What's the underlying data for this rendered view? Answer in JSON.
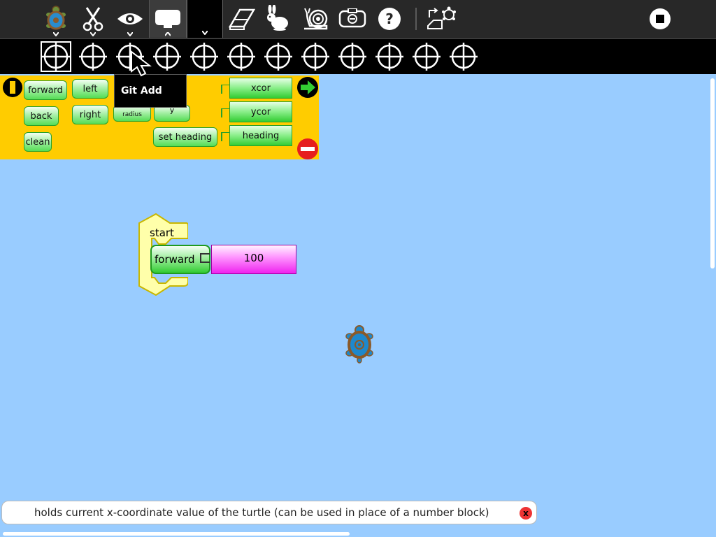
{
  "toolbar": {
    "buttons": [
      {
        "name": "turtle-project-button",
        "icon": "turtle-icon"
      },
      {
        "name": "edit-button",
        "icon": "scissors-icon"
      },
      {
        "name": "view-button",
        "icon": "eye-icon"
      },
      {
        "name": "palette-toggle-button",
        "icon": "palette-icon"
      },
      {
        "name": "eraser-button",
        "icon": "eraser-icon"
      },
      {
        "name": "run-fast-button",
        "icon": "rabbit-icon"
      },
      {
        "name": "run-slow-button",
        "icon": "snail-icon"
      },
      {
        "name": "hide-blocks-button",
        "icon": "hide-blocks-icon"
      },
      {
        "name": "help-button",
        "icon": "help-icon"
      },
      {
        "name": "share-button",
        "icon": "share-turtle-icon"
      },
      {
        "name": "stop-button",
        "icon": "stop-icon"
      }
    ]
  },
  "palette_bar": {
    "count": 12,
    "selected_index": 0,
    "icon": "crosshair-icon"
  },
  "tooltip": {
    "text": "Git Add"
  },
  "palette": {
    "blocks": {
      "forward": "forward",
      "back": "back",
      "clean": "clean",
      "left": "left",
      "right": "right",
      "radius": "radius",
      "y": "y",
      "set_heading": "set heading",
      "xcor": "xcor",
      "ycor": "ycor",
      "heading": "heading"
    }
  },
  "canvas": {
    "start_label": "start",
    "forward_label": "forward",
    "number_value": "100"
  },
  "statusbar": {
    "text": "holds current x-coordinate value of the turtle (can be used in place of a number block)",
    "close_label": "x"
  },
  "colors": {
    "canvas_bg": "#99ccff",
    "palette_bg": "#ffcc00",
    "toolbar_bg": "#282828",
    "block_green": "#55dd55",
    "number_magenta": "#ee22ee",
    "start_yellow": "#ffff66"
  }
}
